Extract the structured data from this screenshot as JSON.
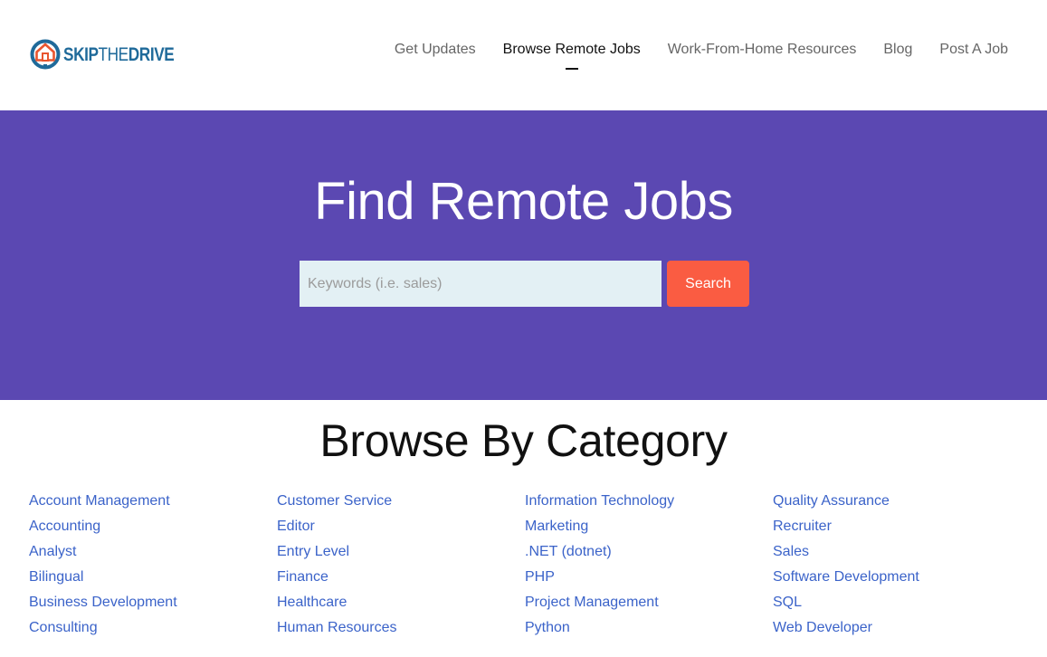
{
  "header": {
    "logo": {
      "bold_left": "SKIP",
      "light": "THE",
      "bold_right": "DRIVE",
      "icon": "house-in-circle-icon"
    },
    "nav": [
      {
        "label": "Get Updates",
        "active": false
      },
      {
        "label": "Browse Remote Jobs",
        "active": true
      },
      {
        "label": "Work-From-Home Resources",
        "active": false
      },
      {
        "label": "Blog",
        "active": false
      },
      {
        "label": "Post A Job",
        "active": false
      }
    ]
  },
  "hero": {
    "title": "Find Remote Jobs",
    "search": {
      "placeholder": "Keywords (i.e. sales)",
      "value": "",
      "button_label": "Search"
    },
    "colors": {
      "background": "#5b48b2",
      "button": "#fa5c42",
      "input": "#e3f0f4"
    }
  },
  "browse": {
    "title": "Browse By Category",
    "columns": [
      [
        "Account Management",
        "Accounting",
        "Analyst",
        "Bilingual",
        "Business Development",
        "Consulting"
      ],
      [
        "Customer Service",
        "Editor",
        "Entry Level",
        "Finance",
        "Healthcare",
        "Human Resources"
      ],
      [
        "Information Technology",
        "Marketing",
        ".NET (dotnet)",
        "PHP",
        "Project Management",
        "Python"
      ],
      [
        "Quality Assurance",
        "Recruiter",
        "Sales",
        "Software Development",
        "SQL",
        "Web Developer"
      ]
    ],
    "link_color": "#3b63c9"
  }
}
